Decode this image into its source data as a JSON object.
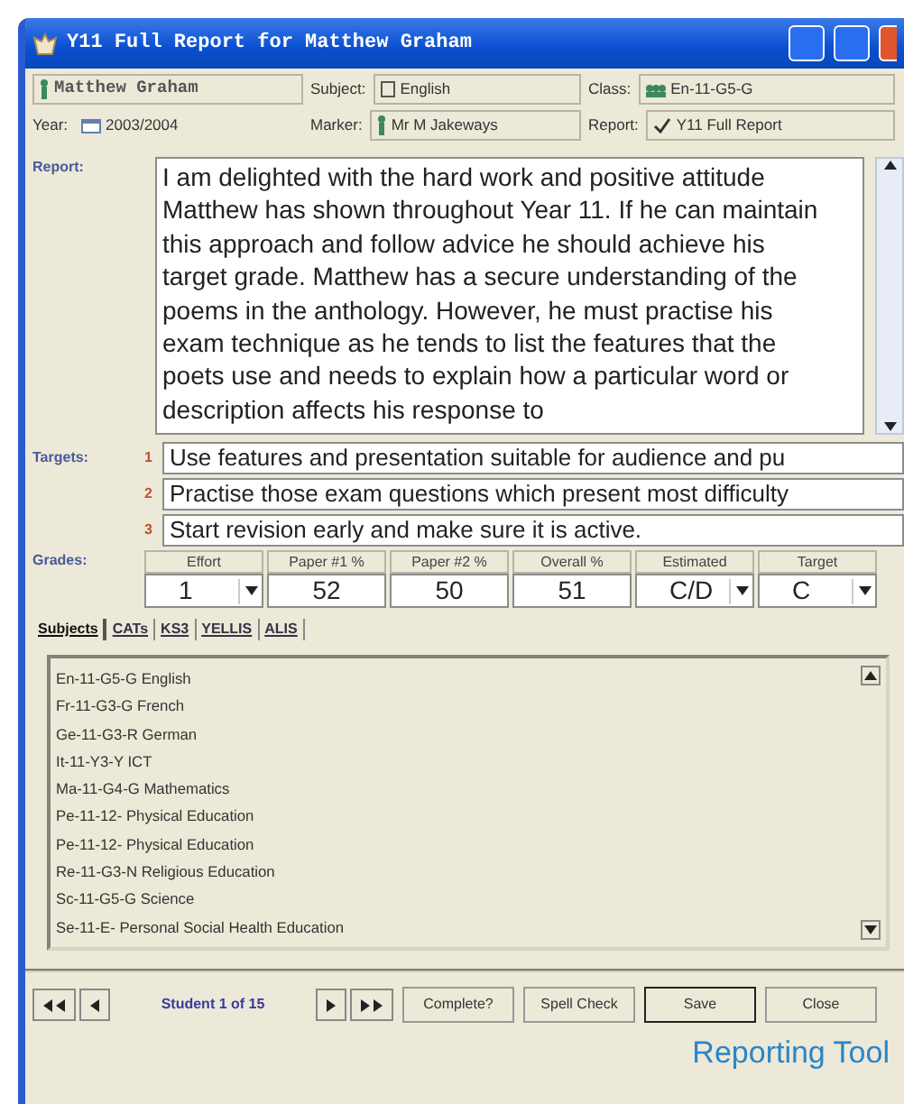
{
  "window": {
    "title": "Y11 Full Report for Matthew Graham"
  },
  "header": {
    "student": "Matthew Graham",
    "year_label": "Year:",
    "year": "2003/2004",
    "subject_label": "Subject:",
    "subject": "English",
    "marker_label": "Marker:",
    "marker": "Mr M Jakeways",
    "class_label": "Class:",
    "class": "En-11-G5-G",
    "report_label": "Report:",
    "report": "Y11 Full Report"
  },
  "report": {
    "label": "Report:",
    "text": "I am delighted with the hard work and positive attitude Matthew has shown throughout Year 11.  If he can maintain this approach and follow advice he should achieve his target grade.  Matthew has a secure understanding of the poems in the anthology.  However, he must practise his exam technique as he tends to list the features that the poets use and needs to explain how a particular word or description affects his response to"
  },
  "targets": {
    "label": "Targets:",
    "items": [
      {
        "number": "1",
        "text": "Use features and presentation suitable for audience and pu"
      },
      {
        "number": "2",
        "text": "Practise those exam questions which present most difficulty"
      },
      {
        "number": "3",
        "text": "Start revision early and make sure it is active."
      }
    ]
  },
  "grades": {
    "label": "Grades:",
    "columns": [
      {
        "heading": "Effort",
        "value": "1",
        "kind": "select"
      },
      {
        "heading": "Paper #1 %",
        "value": "52",
        "kind": "number"
      },
      {
        "heading": "Paper #2 %",
        "value": "50",
        "kind": "number"
      },
      {
        "heading": "Overall %",
        "value": "51",
        "kind": "number"
      },
      {
        "heading": "Estimated",
        "value": "C/D",
        "kind": "select"
      },
      {
        "heading": "Target",
        "value": "C",
        "kind": "select"
      }
    ]
  },
  "tabs": [
    {
      "label": "Subjects",
      "selected": true
    },
    {
      "label": "CATs",
      "selected": false
    },
    {
      "label": "KS3",
      "selected": false
    },
    {
      "label": "YELLIS",
      "selected": false
    },
    {
      "label": "ALIS",
      "selected": false
    }
  ],
  "subjects": [
    "En-11-G5-G English",
    "Fr-11-G3-G French",
    "Ge-11-G3-R German",
    "It-11-Y3-Y ICT",
    "Ma-11-G4-G Mathematics",
    "Pe-11-12- Physical Education",
    "Pe-11-12- Physical Education",
    "Re-11-G3-N Religious Education",
    "Sc-11-G5-G Science",
    "Se-11-E- Personal Social Health Education"
  ],
  "navigator": {
    "record": "Student 1 of 15"
  },
  "buttons": [
    "Complete?",
    "Spell Check",
    "Save",
    "Close"
  ],
  "caption": "Reporting Tool"
}
